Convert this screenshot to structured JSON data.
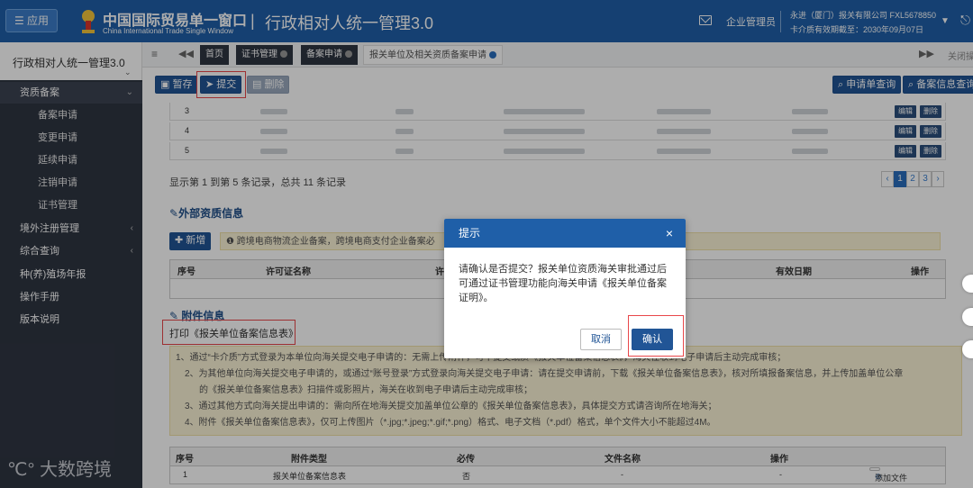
{
  "header": {
    "app_label": "☰ 应用",
    "brand_cn": "中国国际贸易单一窗口",
    "brand_en": "China International Trade Single Window",
    "separator": "|",
    "system_title": "行政相对人统一管理3.0",
    "role": "企业管理员",
    "role_separator": "|",
    "company": "永进（厦门）报关有限公司 FXL5678850",
    "validity": "卡介质有效期截至：2030年09月07日",
    "colors": {
      "primary": "#1f5fa8",
      "sidebar": "#2f3542",
      "highlight": "#e8474a"
    }
  },
  "sidebar": {
    "title": "行政相对人统一管理3.0",
    "items": [
      {
        "label": "资质备案",
        "type": "section",
        "arrow": "⌄"
      },
      {
        "label": "备案申请",
        "type": "sub"
      },
      {
        "label": "变更申请",
        "type": "sub"
      },
      {
        "label": "延续申请",
        "type": "sub"
      },
      {
        "label": "注销申请",
        "type": "sub"
      },
      {
        "label": "证书管理",
        "type": "sub"
      },
      {
        "label": "境外注册管理",
        "type": "group",
        "arrow": "‹"
      },
      {
        "label": "综合查询",
        "type": "group",
        "arrow": "‹"
      },
      {
        "label": "种(养)殖场年报",
        "type": "group"
      },
      {
        "label": "操作手册",
        "type": "group"
      },
      {
        "label": "版本说明",
        "type": "group"
      }
    ],
    "watermark": "大数跨境"
  },
  "tabs": {
    "items": [
      {
        "label": "首页"
      },
      {
        "label": "证书管理"
      },
      {
        "label": "备案申请"
      },
      {
        "label": "报关单位及相关资质备案申请"
      }
    ],
    "close_label": "关闭操"
  },
  "toolbar": {
    "save": "暂存",
    "submit": "提交",
    "delete": "删除",
    "query_apply": "申请单查询",
    "query_record": "备案信息查询"
  },
  "table1": {
    "rows": [
      {
        "n": "3"
      },
      {
        "n": "4"
      },
      {
        "n": "5"
      }
    ],
    "edit": "编辑",
    "del": "删除",
    "page_info": "显示第 1 到第 5 条记录，总共 11 条记录",
    "pager": [
      "‹",
      "1",
      "2",
      "3",
      "›"
    ]
  },
  "external": {
    "title": "外部资质信息",
    "add": "新增",
    "tip": "跨境电商物流企业备案，跨境电商支付企业备案必",
    "headers": [
      "序号",
      "许可证名称",
      "许",
      "有效日期",
      "操作"
    ]
  },
  "attachment": {
    "title": "附件信息",
    "print": "打印《报关单位备案信息表》",
    "notes": [
      "1、通过“卡介质”方式登录为本单位向海关提交电子申请的：无需上传附件，可不提交纸质《报关单位备案信息表》，海关在收到电子申请后主动完成审核；",
      "2、为其他单位向海关提交电子申请的，或通过“账号登录”方式登录向海关提交电子申请：请在提交申请前，下载《报关单位备案信息表》，核对所填报备案信息，并上传加盖单位公章",
      "的《报关单位备案信息表》扫描件或影照片，海关在收到电子申请后主动完成审核；",
      "3、通过其他方式向海关提出申请的：需向所在地海关提交加盖单位公章的《报关单位备案信息表》，具体提交方式请咨询所在地海关；",
      "4、附件《报关单位备案信息表》，仅可上传图片（*.jpg;*.jpeg;*.gif;*.png）格式、电子文档（*.pdf）格式，单个文件大小不能超过4M。"
    ],
    "headers": [
      "序号",
      "附件类型",
      "必传",
      "文件名称",
      "操作"
    ],
    "row": {
      "n": "1",
      "type": "报关单位备案信息表",
      "required": "否",
      "file": "-",
      "dash": "-",
      "action": "添加文件"
    }
  },
  "modal": {
    "title": "提示",
    "close": "×",
    "message": "请确认是否提交？报关单位资质海关审批通过后可通过证书管理功能向海关申请《报关单位备案证明》。",
    "cancel": "取消",
    "confirm": "确认"
  }
}
